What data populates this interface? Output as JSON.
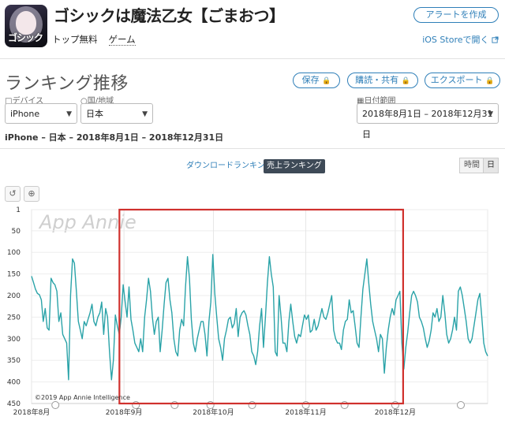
{
  "app": {
    "title": "ゴシックは魔法乙女【ごまおつ】",
    "icon_name": "app-icon",
    "icon_text": "ゴシック",
    "category_label": "トップ無料",
    "category_value": "ゲーム",
    "alert_button": "アラートを作成",
    "ios_store_link": "iOS Storeで開く"
  },
  "page": {
    "section_title": "ランキング推移",
    "save_button": "保存",
    "share_button": "購読・共有",
    "export_button": "エクスポート"
  },
  "filters": {
    "device_label": "デバイス",
    "device_value": "iPhone",
    "country_label": "国/地域",
    "country_value": "日本",
    "date_label": "日付範囲",
    "date_value": "2018年8月1日 – 2018年12月31日"
  },
  "summary": "iPhone – 日本 – 2018年8月1日 – 2018年12月31日",
  "tabs": {
    "download": "ダウンロードランキング",
    "revenue": "売上ランキング"
  },
  "granularity": {
    "hourly": "時間",
    "daily": "日"
  },
  "chart": {
    "watermark": "App Annie",
    "copyright": "©2019 App Annie Intelligence"
  },
  "colors": {
    "line": "#2aa3a8",
    "highlight": "#d0312d",
    "accent": "#2f7fb8"
  },
  "chart_data": {
    "type": "line",
    "y_reversed": true,
    "ylim": [
      450,
      1
    ],
    "yticks": [
      "1",
      "50",
      "100",
      "150",
      "200",
      "250",
      "300",
      "350",
      "400",
      "450"
    ],
    "xticks": [
      "2018年8月",
      "2018年9月",
      "2018年10月",
      "2018年11月",
      "2018年12月"
    ],
    "series": [
      {
        "values": [
          155,
          170,
          185,
          195,
          198,
          210,
          260,
          230,
          275,
          280,
          160,
          170,
          175,
          190,
          260,
          240,
          290,
          300,
          310,
          395,
          200,
          115,
          125,
          190,
          260,
          280,
          300,
          260,
          270,
          255,
          240,
          220,
          260,
          270,
          250,
          240,
          215,
          290,
          230,
          250,
          330,
          395,
          350,
          245,
          270,
          290,
          250,
          175,
          215,
          250,
          180,
          255,
          280,
          310,
          320,
          330,
          300,
          330,
          250,
          210,
          160,
          190,
          250,
          290,
          260,
          250,
          330,
          280,
          220,
          170,
          160,
          210,
          240,
          300,
          330,
          340,
          280,
          255,
          270,
          180,
          110,
          160,
          255,
          310,
          330,
          300,
          280,
          260,
          260,
          290,
          340,
          260,
          215,
          105,
          195,
          250,
          300,
          320,
          350,
          300,
          280,
          255,
          250,
          275,
          265,
          230,
          295,
          250,
          240,
          235,
          245,
          270,
          290,
          330,
          340,
          360,
          330,
          270,
          230,
          320,
          250,
          170,
          110,
          150,
          180,
          330,
          340,
          200,
          250,
          310,
          310,
          330,
          260,
          220,
          260,
          295,
          310,
          290,
          295,
          270,
          245,
          255,
          245,
          285,
          280,
          255,
          280,
          270,
          250,
          230,
          250,
          255,
          240,
          220,
          200,
          280,
          300,
          310,
          310,
          325,
          280,
          260,
          255,
          210,
          240,
          235,
          270,
          310,
          320,
          250,
          185,
          150,
          115,
          170,
          220,
          260,
          280,
          300,
          330,
          290,
          300,
          380,
          320,
          280,
          250,
          230,
          245,
          210,
          200,
          190,
          310,
          370,
          320,
          285,
          240,
          200,
          190,
          200,
          215,
          250,
          260,
          275,
          300,
          320,
          305,
          280,
          240,
          250,
          230,
          260,
          250,
          200,
          240,
          290,
          310,
          300,
          280,
          250,
          280,
          190,
          180,
          200,
          230,
          260,
          300,
          310,
          300,
          270,
          240,
          210,
          195,
          250,
          310,
          330,
          340
        ]
      }
    ]
  }
}
